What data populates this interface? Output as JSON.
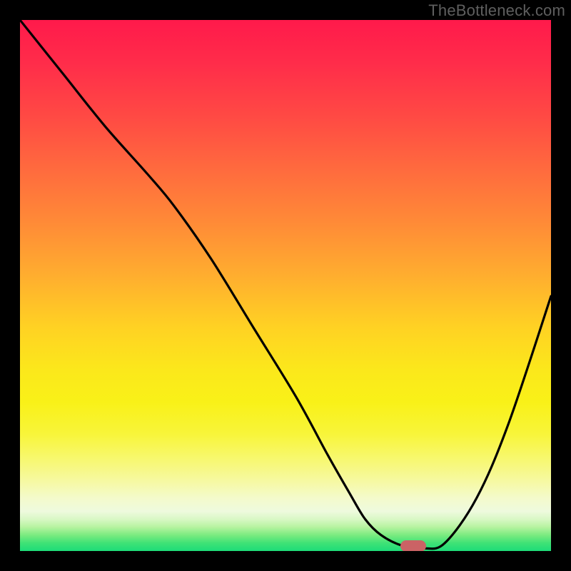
{
  "watermark": "TheBottleneck.com",
  "chart_data": {
    "type": "line",
    "title": "",
    "xlabel": "",
    "ylabel": "",
    "xlim": [
      0,
      100
    ],
    "ylim": [
      0,
      100
    ],
    "grid": false,
    "legend": false,
    "background_gradient": {
      "top": "#ff1a4b",
      "mid_upper": "#ff8a37",
      "mid": "#ffd223",
      "mid_lower": "#f7f873",
      "bottom": "#1ddc78"
    },
    "series": [
      {
        "name": "bottleneck-curve",
        "color": "#000000",
        "x": [
          0,
          8,
          16,
          24,
          29,
          36,
          44,
          52,
          58,
          62,
          65,
          68,
          72,
          76,
          80,
          86,
          92,
          100
        ],
        "y": [
          100,
          90,
          80,
          71,
          65,
          55,
          42,
          29,
          18,
          11,
          6,
          3,
          1,
          0.5,
          1.5,
          10,
          24,
          48
        ]
      }
    ],
    "marker": {
      "name": "optimal-point",
      "x": 74,
      "y": 1,
      "color": "#cb6365",
      "shape": "pill"
    }
  }
}
